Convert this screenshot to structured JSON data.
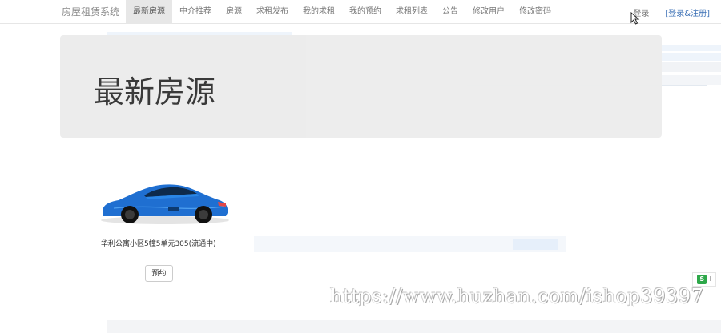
{
  "navbar": {
    "brand": "房屋租赁系统",
    "items": [
      {
        "label": "最新房源",
        "active": true
      },
      {
        "label": "中介推荐",
        "active": false
      },
      {
        "label": "房源",
        "active": false
      },
      {
        "label": "求租发布",
        "active": false
      },
      {
        "label": "我的求租",
        "active": false
      },
      {
        "label": "我的预约",
        "active": false
      },
      {
        "label": "求租列表",
        "active": false
      },
      {
        "label": "公告",
        "active": false
      },
      {
        "label": "修改用户",
        "active": false
      },
      {
        "label": "修改密码",
        "active": false
      }
    ],
    "login_label": "登录",
    "register_label": "[登录&注册]"
  },
  "jumbotron": {
    "title": "最新房源"
  },
  "listings": [
    {
      "image_icon": "car-photo",
      "address": "华利公寓小区5幢5单元305(流通中)",
      "reserve_label": "预约"
    }
  ],
  "watermark": {
    "text": "https://www.huzhan.com/ishop39397"
  },
  "colors": {
    "active_nav_bg": "#e7e7e7",
    "jumbotron_bg": "#ececec",
    "link_blue": "#3a6fb5",
    "car_blue": "#1f6fd1",
    "widget_green": "#2ea84a"
  },
  "side_widget": {
    "icon": "s-logo-icon",
    "label": "S"
  }
}
